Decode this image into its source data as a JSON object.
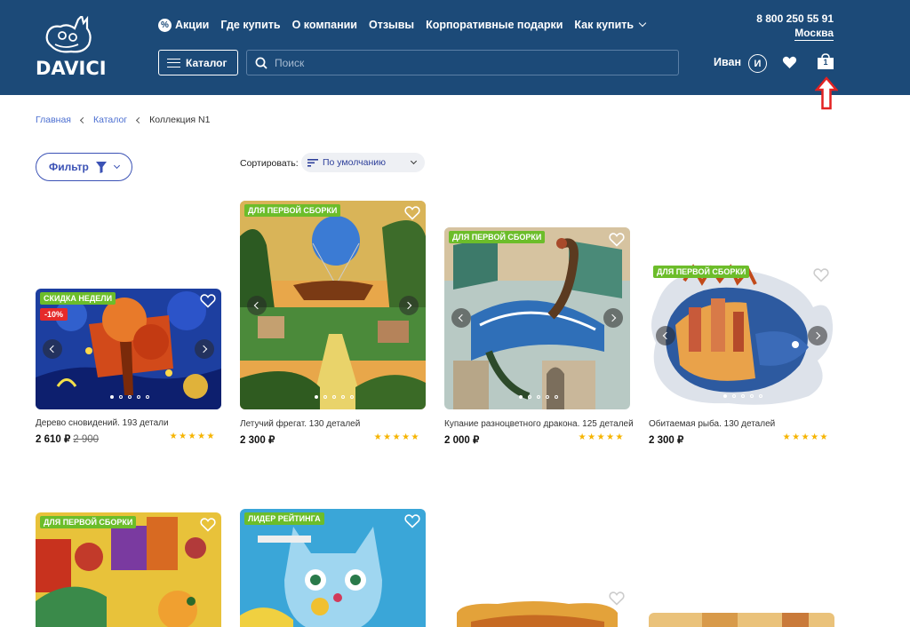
{
  "header": {
    "logo_text": "DAVICI",
    "nav": [
      {
        "label": "Акции",
        "icon": "percent-icon"
      },
      {
        "label": "Где купить"
      },
      {
        "label": "О компании"
      },
      {
        "label": "Отзывы"
      },
      {
        "label": "Корпоративные подарки"
      },
      {
        "label": "Как купить",
        "dropdown": true
      }
    ],
    "phone": "8 800 250 55 91",
    "city": "Москва",
    "catalog_label": "Каталог",
    "search_placeholder": "Поиск",
    "user_name": "Иван",
    "avatar_initial": "И",
    "cart_count": "1"
  },
  "breadcrumb": [
    "Главная",
    "Каталог",
    "Коллекция N1"
  ],
  "toolbar": {
    "filter_label": "Фильтр",
    "sort_label": "Сортировать:",
    "sort_value": "По умолчанию"
  },
  "products": [
    {
      "badge": "СКИДКА НЕДЕЛИ",
      "discount": "-10%",
      "name": "Дерево сновидений. 193 детали",
      "price": "2 610 ₽",
      "old_price": "2 900",
      "rating": 5
    },
    {
      "badge": "ДЛЯ ПЕРВОЙ СБОРКИ",
      "name": "Летучий фрегат. 130 деталей",
      "price": "2 300 ₽",
      "rating": 5
    },
    {
      "badge": "ДЛЯ ПЕРВОЙ СБОРКИ",
      "name": "Купание разноцветного дракона. 125 деталей",
      "price": "2 000 ₽",
      "rating": 5
    },
    {
      "badge": "ДЛЯ ПЕРВОЙ СБОРКИ",
      "name": "Обитаемая рыба. 130 деталей",
      "price": "2 300 ₽",
      "rating": 5
    },
    {
      "badge": "ДЛЯ ПЕРВОЙ СБОРКИ"
    },
    {
      "badge": "ЛИДЕР РЕЙТИНГА"
    },
    {},
    {}
  ],
  "colors": {
    "header_bg": "#1c4a78",
    "badge_green": "#6cbd2a",
    "discount_red": "#e52a2a",
    "star": "#f6b400",
    "accent": "#3b52b5"
  }
}
